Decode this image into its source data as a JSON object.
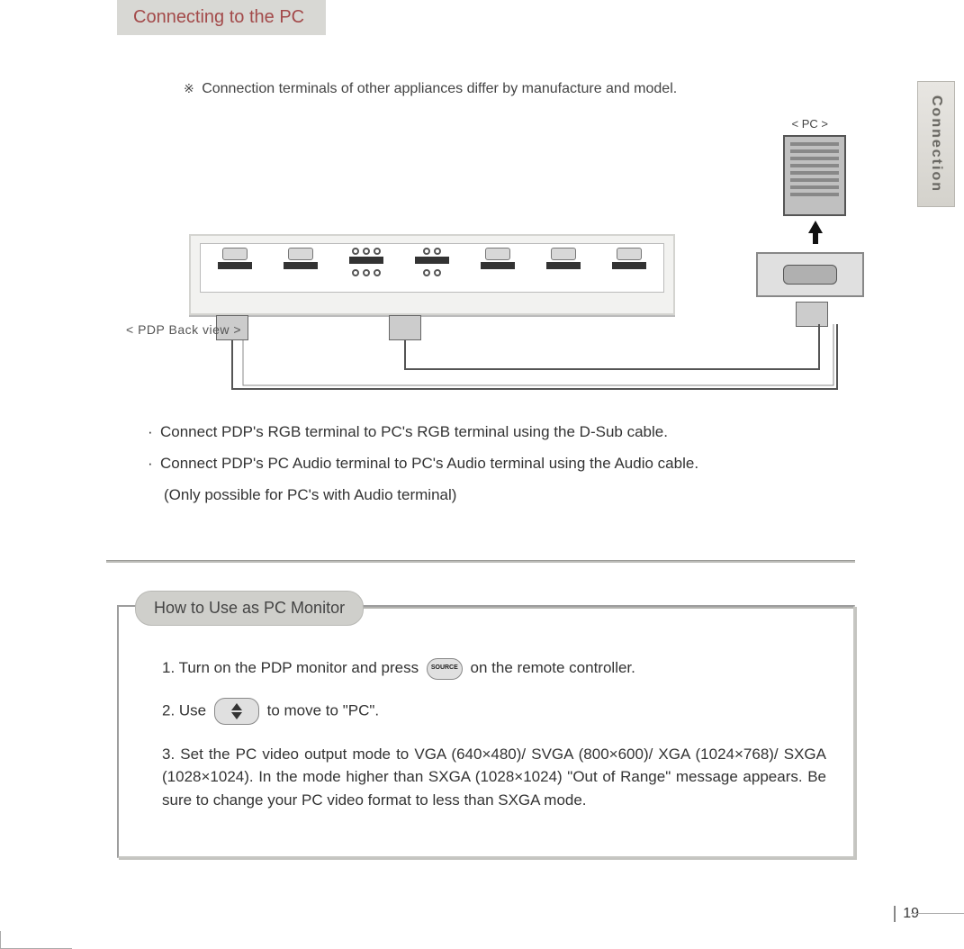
{
  "sideTab": "Connection",
  "sectionTitle": "Connecting to the PC",
  "noteSymbol": "※",
  "noteText": "Connection terminals of other appliances differ by manufacture and model.",
  "diagram": {
    "pcLabel": "< PC >",
    "pdpCaption": "< PDP Back view >"
  },
  "bullets": {
    "b1": "Connect PDP's RGB terminal to PC's RGB terminal using the D-Sub cable.",
    "b2": "Connect PDP's PC Audio terminal to PC's Audio terminal using the Audio cable.",
    "b2sub": "(Only possible for PC's with Audio terminal)"
  },
  "howto": {
    "title": "How to Use as PC Monitor",
    "step1a": "1. Turn on the PDP monitor and press",
    "step1b": "on the remote controller.",
    "sourceLabel": "SOURCE",
    "step2a": "2. Use",
    "step2b": "to move to \"PC\".",
    "step3": "3. Set the PC video output mode to VGA (640×480)/ SVGA (800×600)/ XGA (1024×768)/ SXGA (1028×1024). In the mode higher than SXGA (1028×1024) \"Out of Range\" message appears. Be sure to change your PC video format to less than SXGA mode."
  },
  "pageNumber": "19"
}
